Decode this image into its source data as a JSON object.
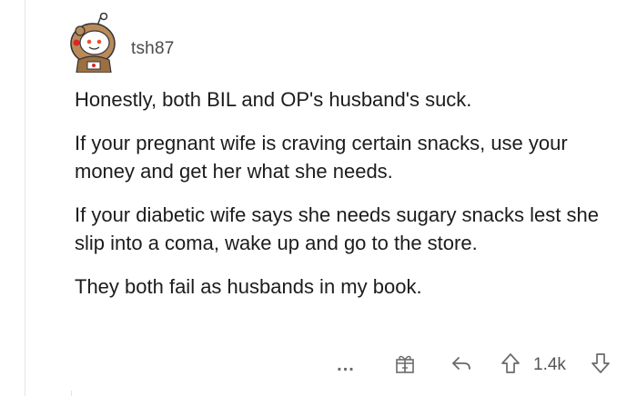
{
  "comment": {
    "username": "tsh87",
    "paragraphs": [
      "Honestly, both BIL and OP's husband's suck.",
      "If your pregnant wife is craving certain snacks, use your money and get her what she needs.",
      "If your diabetic wife says she needs sugary snacks lest she slip into a coma, wake up and go to the store.",
      "They both fail as husbands in my book."
    ]
  },
  "actions": {
    "more_label": "...",
    "score": "1.4k"
  },
  "icons": {
    "avatar": "snoo-avatar-icon",
    "award": "gift-award-icon",
    "reply": "reply-arrow-icon",
    "upvote": "upvote-arrow-icon",
    "downvote": "downvote-arrow-icon"
  },
  "colors": {
    "text": "#1c1c1c",
    "muted": "#6a6a6a",
    "thread_line": "#e6e6e6"
  }
}
